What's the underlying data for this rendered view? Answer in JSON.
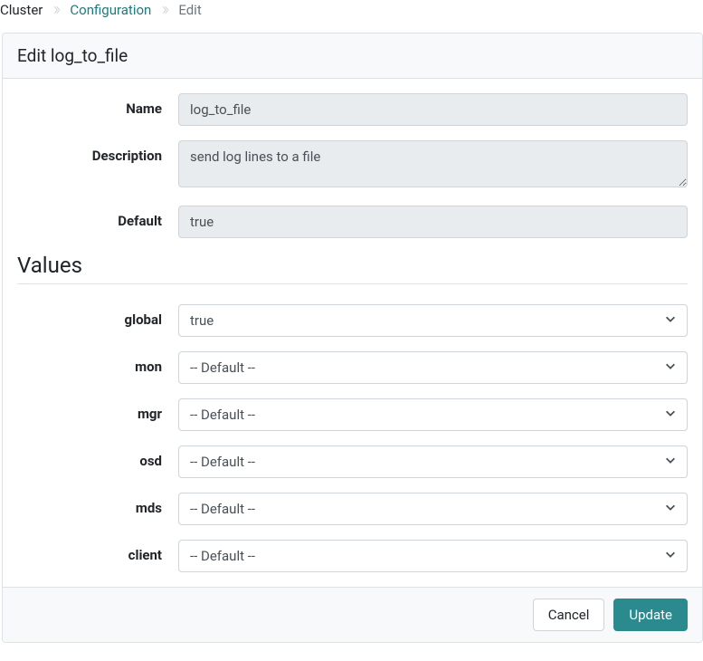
{
  "breadcrumb": {
    "cluster": "Cluster",
    "configuration": "Configuration",
    "edit": "Edit"
  },
  "panel": {
    "title": "Edit log_to_file"
  },
  "form": {
    "name_label": "Name",
    "name_value": "log_to_file",
    "description_label": "Description",
    "description_value": "send log lines to a file",
    "default_label": "Default",
    "default_value": "true"
  },
  "values": {
    "section_title": "Values",
    "rows": [
      {
        "label": "global",
        "value": "true"
      },
      {
        "label": "mon",
        "value": "-- Default --"
      },
      {
        "label": "mgr",
        "value": "-- Default --"
      },
      {
        "label": "osd",
        "value": "-- Default --"
      },
      {
        "label": "mds",
        "value": "-- Default --"
      },
      {
        "label": "client",
        "value": "-- Default --"
      }
    ]
  },
  "footer": {
    "cancel": "Cancel",
    "update": "Update"
  }
}
